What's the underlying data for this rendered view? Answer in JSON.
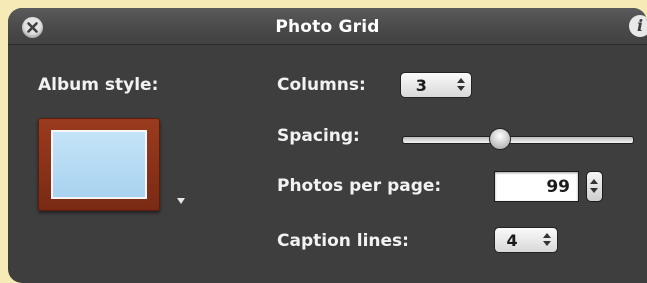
{
  "window": {
    "title": "Photo Grid",
    "close_icon": "close-icon",
    "info_icon": "info-icon",
    "info_glyph": "i"
  },
  "album_style": {
    "label": "Album style:",
    "thumbnail": "album-style-thumbnail",
    "frame_color": "#8b3419",
    "photo_color": "#b5d9f3"
  },
  "columns": {
    "label": "Columns:",
    "value": "3"
  },
  "spacing": {
    "label": "Spacing:",
    "level": 0.42
  },
  "photos_per_page": {
    "label": "Photos per page:",
    "value": "99"
  },
  "caption_lines": {
    "label": "Caption lines:",
    "value": "4"
  }
}
